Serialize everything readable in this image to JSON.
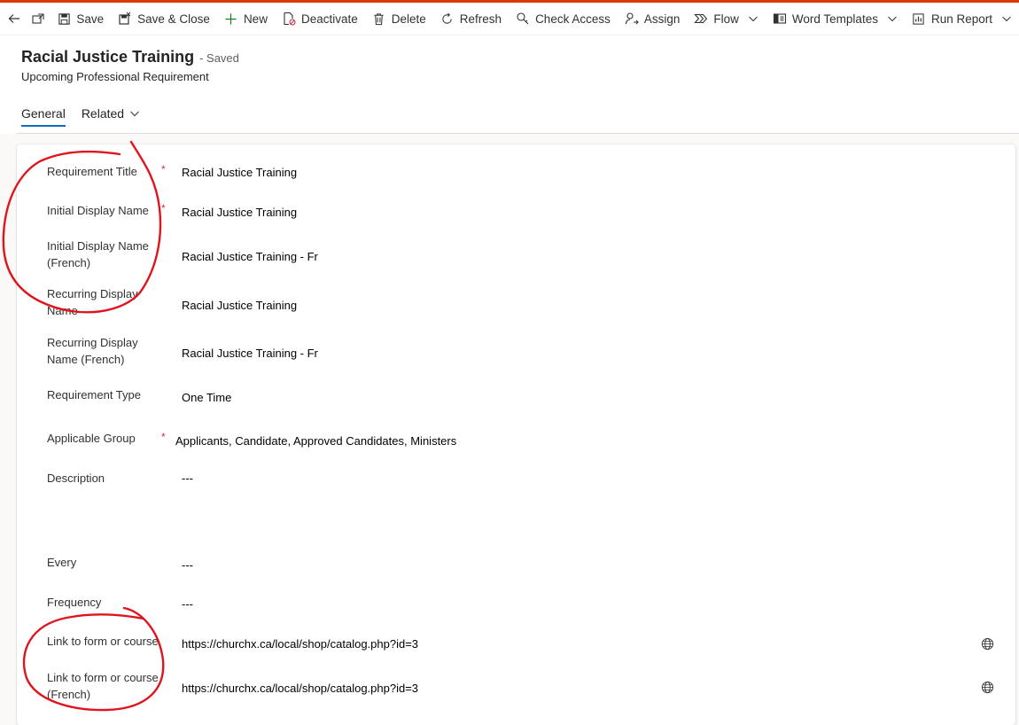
{
  "toolbar": {
    "back_icon": "arrow-left-icon",
    "popout_icon": "open-in-new-window-icon",
    "items": [
      {
        "label": "Save",
        "icon": "save-icon"
      },
      {
        "label": "Save & Close",
        "icon": "save-close-icon"
      },
      {
        "label": "New",
        "icon": "plus-icon"
      },
      {
        "label": "Deactivate",
        "icon": "deactivate-icon"
      },
      {
        "label": "Delete",
        "icon": "trash-icon"
      },
      {
        "label": "Refresh",
        "icon": "refresh-icon"
      },
      {
        "label": "Check Access",
        "icon": "check-access-icon"
      },
      {
        "label": "Assign",
        "icon": "assign-icon"
      },
      {
        "label": "Flow",
        "icon": "flow-icon"
      },
      {
        "label": "Word Templates",
        "icon": "word-templates-icon"
      },
      {
        "label": "Run Report",
        "icon": "run-report-icon"
      }
    ]
  },
  "header": {
    "title": "Racial Justice Training",
    "saved_status": "- Saved",
    "entity_type": "Upcoming Professional Requirement"
  },
  "tabs": [
    {
      "label": "General",
      "active": true
    },
    {
      "label": "Related",
      "active": false
    }
  ],
  "form": {
    "fields": [
      {
        "label": "Requirement Title",
        "required": true,
        "value": "Racial Justice Training"
      },
      {
        "label": "Initial Display Name",
        "required": true,
        "value": "Racial Justice Training"
      },
      {
        "label": "Initial Display Name (French)",
        "required": false,
        "value": "Racial Justice Training - Fr"
      },
      {
        "label": "Recurring Display Name",
        "required": false,
        "value": "Racial Justice Training"
      },
      {
        "label": "Recurring Display Name (French)",
        "required": false,
        "value": "Racial Justice Training - Fr"
      },
      {
        "label": "Requirement Type",
        "required": false,
        "value": "One Time"
      },
      {
        "label": "Applicable Group",
        "required": true,
        "value": "Applicants, Candidate, Approved Candidates, Ministers"
      },
      {
        "label": "Description",
        "required": false,
        "value": "---"
      },
      {
        "label": "Every",
        "required": false,
        "value": "---"
      },
      {
        "label": "Frequency",
        "required": false,
        "value": "---"
      },
      {
        "label": "Link to form or course",
        "required": false,
        "value": "https://churchx.ca/local/shop/catalog.php?id=3",
        "icon": "globe-icon"
      },
      {
        "label": "Link to form or course (French)",
        "required": false,
        "value": "https://churchx.ca/local/shop/catalog.php?id=3",
        "icon": "globe-icon"
      }
    ],
    "required_marker": "*"
  },
  "colors": {
    "accent_top": "#d83b01",
    "tab_underline": "#0f6cbd",
    "required_star": "#c4314b",
    "annotation": "#e0141e"
  }
}
